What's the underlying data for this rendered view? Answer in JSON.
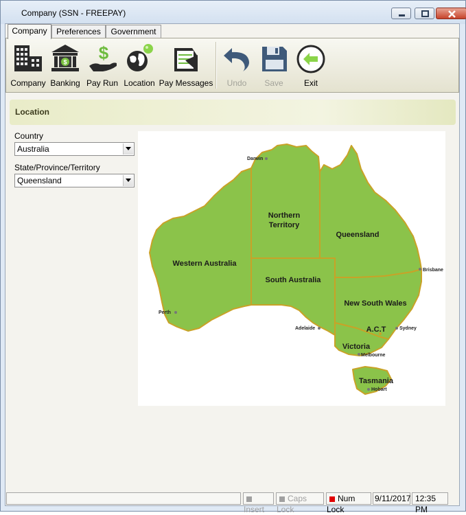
{
  "window": {
    "title": "Company (SSN - FREEPAY)"
  },
  "tabs": [
    {
      "label": "Company"
    },
    {
      "label": "Preferences"
    },
    {
      "label": "Government"
    }
  ],
  "toolbar": {
    "company": "Company",
    "banking": "Banking",
    "payrun": "Pay Run",
    "location": "Location",
    "paymessages": "Pay Messages",
    "undo": "Undo",
    "save": "Save",
    "exit": "Exit"
  },
  "section": {
    "title": "Location"
  },
  "form": {
    "country_label": "Country",
    "country_value": "Australia",
    "state_label": "State/Province/Territory",
    "state_value": "Queensland"
  },
  "map": {
    "regions": {
      "wa": "Western Australia",
      "nt_line1": "Northern",
      "nt_line2": "Territory",
      "qld": "Queensland",
      "sa": "South Australia",
      "nsw": "New South Wales",
      "act": "A.C.T",
      "vic": "Victoria",
      "tas": "Tasmania"
    },
    "cities": {
      "darwin": "Darwin",
      "brisbane": "Brisbane",
      "perth": "Perth",
      "adelaide": "Adelaide",
      "sydney": "Sydney",
      "melbourne": "Melbourne",
      "hobart": "Hobart"
    }
  },
  "status": {
    "insert": "Insert",
    "capslock": "Caps Lock",
    "numlock": "Num Lock",
    "date": "9/11/2017",
    "time": "12:35 PM"
  },
  "colors": {
    "land": "#8bc34a",
    "coast": "#c9a227",
    "numlock_on": "#e00000",
    "indicator_off": "#a0a0a0"
  }
}
